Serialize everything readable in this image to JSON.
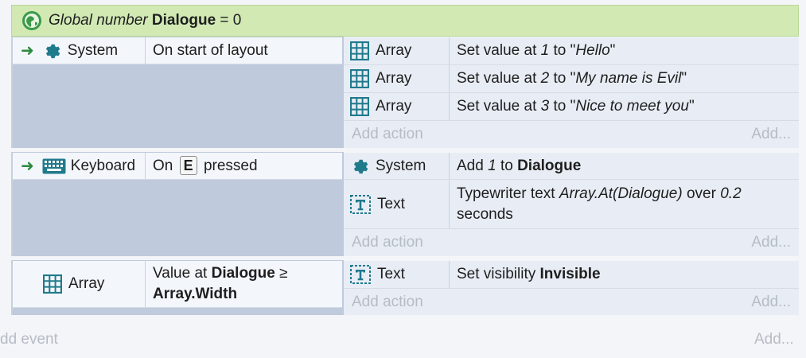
{
  "global_var": {
    "prefix": "Global number",
    "name": "Dialogue",
    "suffix": "= 0"
  },
  "events": [
    {
      "condition": {
        "object": "System",
        "text": "On start of layout"
      },
      "actions": [
        {
          "object": "Array",
          "pre": "Set value at ",
          "arg1": "1",
          "mid": " to \"",
          "arg2": "Hello",
          "post": "\""
        },
        {
          "object": "Array",
          "pre": "Set value at ",
          "arg1": "2",
          "mid": " to \"",
          "arg2": "My name is Evil",
          "post": "\""
        },
        {
          "object": "Array",
          "pre": "Set value at ",
          "arg1": "3",
          "mid": " to \"",
          "arg2": "Nice to meet you",
          "post": "\""
        }
      ],
      "add_action": "Add action",
      "add": "Add..."
    },
    {
      "condition": {
        "object": "Keyboard",
        "pre": "On",
        "key": "E",
        "post": "pressed"
      },
      "actions": [
        {
          "object": "System",
          "pre": "Add ",
          "arg1": "1",
          "mid": " to ",
          "bold": "Dialogue"
        },
        {
          "object": "Text",
          "line1_pre": "Typewriter text ",
          "line1_arg": "Array.At(Dialogue)",
          "line1_mid": " over ",
          "line1_arg2": "0.2",
          "line2": "seconds"
        }
      ],
      "add_action": "Add action",
      "add": "Add..."
    },
    {
      "condition": {
        "object": "Array",
        "line1_pre": "Value at ",
        "line1_bold": "Dialogue",
        "line1_post": " ≥",
        "line2_bold": "Array.Width"
      },
      "actions": [
        {
          "object": "Text",
          "pre": "Set visibility ",
          "bold": "Invisible"
        }
      ],
      "add_action": "Add action",
      "add": "Add..."
    }
  ],
  "footer": {
    "add_event": "dd event",
    "add": "Add..."
  },
  "colors": {
    "global_bg": "#d2e9b4",
    "event_bg": "#bfcbdc",
    "icon_teal": "#1f7a8c",
    "trigger_arrow": "#2a8a3e"
  },
  "icons": [
    "globe-icon",
    "gear-icon",
    "keyboard-icon",
    "array-grid-icon",
    "text-object-icon",
    "trigger-arrow-icon"
  ]
}
